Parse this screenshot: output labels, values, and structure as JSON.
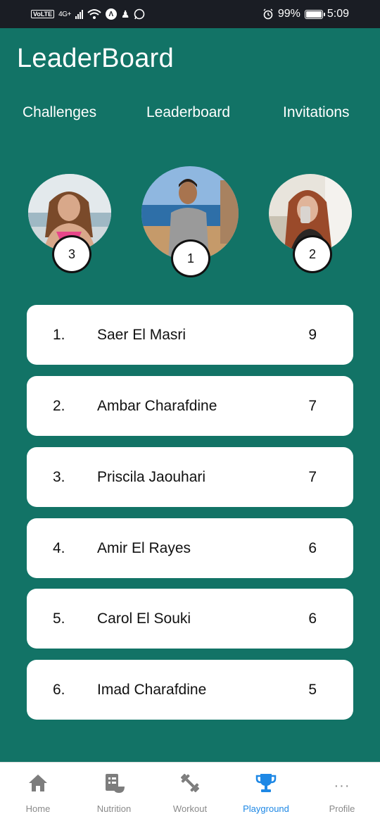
{
  "status_bar": {
    "volte": "VoLTE",
    "network": "4G+",
    "battery": "99%",
    "battery_level": 0.99,
    "time": "5:09"
  },
  "header": {
    "title": "LeaderBoard"
  },
  "tabs": [
    {
      "label": "Challenges"
    },
    {
      "label": "Leaderboard"
    },
    {
      "label": "Invitations"
    }
  ],
  "podium": [
    {
      "rank": "3"
    },
    {
      "rank": "1"
    },
    {
      "rank": "2"
    }
  ],
  "leaderboard": [
    {
      "position": "1.",
      "name": "Saer El Masri",
      "score": "9"
    },
    {
      "position": "2.",
      "name": "Ambar Charafdine",
      "score": "7"
    },
    {
      "position": "3.",
      "name": "Priscila Jaouhari",
      "score": "7"
    },
    {
      "position": "4.",
      "name": "Amir El Rayes",
      "score": "6"
    },
    {
      "position": "5.",
      "name": "Carol El Souki",
      "score": "6"
    },
    {
      "position": "6.",
      "name": "Imad Charafdine",
      "score": "5"
    }
  ],
  "bottom_nav": [
    {
      "label": "Home",
      "icon": "home-icon"
    },
    {
      "label": "Nutrition",
      "icon": "nutrition-icon"
    },
    {
      "label": "Workout",
      "icon": "dumbbell-icon"
    },
    {
      "label": "Playground",
      "icon": "trophy-icon",
      "active": true
    },
    {
      "label": "Profile",
      "icon": "more-dots-icon"
    }
  ],
  "colors": {
    "background": "#127366",
    "status_bar": "#1a1d24",
    "active_nav": "#1e88e5",
    "inactive_nav": "#8a8a8a"
  }
}
